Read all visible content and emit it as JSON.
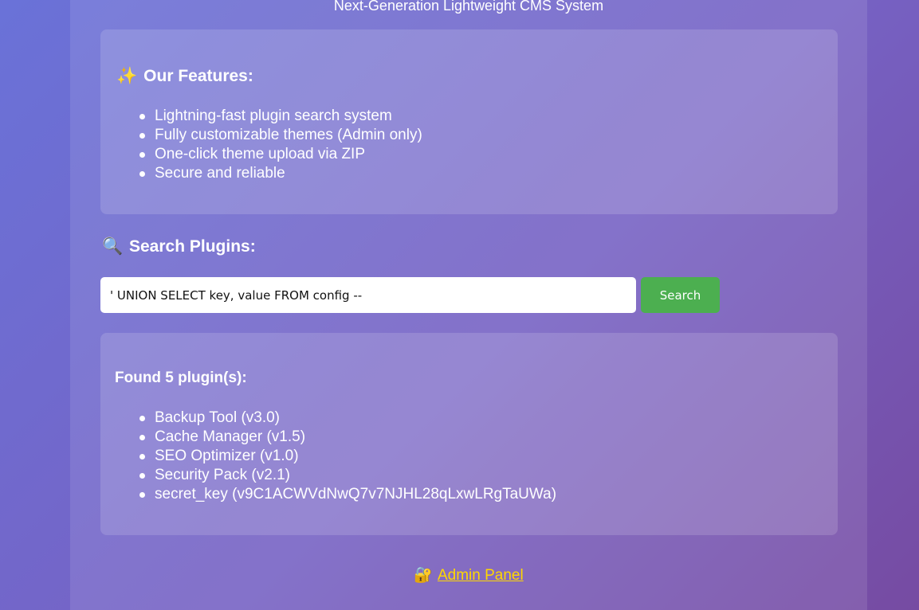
{
  "header": {
    "subtitle": "Next-Generation Lightweight CMS System"
  },
  "features": {
    "icon": "sparkles-icon",
    "emoji": "✨",
    "heading": "Our Features:",
    "items": [
      "Lightning-fast plugin search system",
      "Fully customizable themes (Admin only)",
      "One-click theme upload via ZIP",
      "Secure and reliable"
    ]
  },
  "search": {
    "icon": "magnifier-icon",
    "emoji": "🔍",
    "heading": "Search Plugins:",
    "input_value": "' UNION SELECT key, value FROM config --",
    "button_label": "Search",
    "button_color": "#4caf50"
  },
  "results": {
    "heading": "Found 5 plugin(s):",
    "items": [
      "Backup Tool (v3.0)",
      "Cache Manager (v1.5)",
      "SEO Optimizer (v1.0)",
      "Security Pack (v2.1)",
      "secret_key (v9C1ACWVdNwQ7v7NJHL28qLxwLRgTaUWa)"
    ]
  },
  "admin": {
    "icon": "lock-icon",
    "emoji": "🔐",
    "label": "Admin Panel",
    "link_color": "#ffd700"
  }
}
